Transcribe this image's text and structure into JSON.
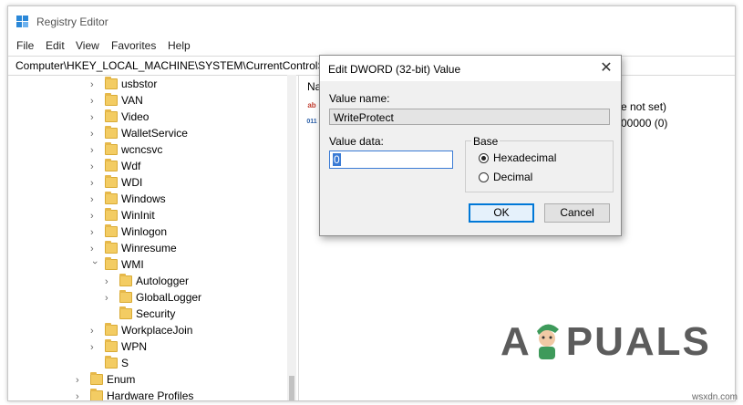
{
  "app": {
    "title": "Registry Editor",
    "menu": [
      "File",
      "Edit",
      "View",
      "Favorites",
      "Help"
    ],
    "address": "Computer\\HKEY_LOCAL_MACHINE\\SYSTEM\\CurrentControlSe"
  },
  "tree": {
    "items": [
      {
        "label": "usbstor",
        "expanded": false
      },
      {
        "label": "VAN",
        "expanded": false
      },
      {
        "label": "Video",
        "expanded": false
      },
      {
        "label": "WalletService",
        "expanded": false
      },
      {
        "label": "wcncsvc",
        "expanded": false
      },
      {
        "label": "Wdf",
        "expanded": false
      },
      {
        "label": "WDI",
        "expanded": false
      },
      {
        "label": "Windows",
        "expanded": false
      },
      {
        "label": "WinInit",
        "expanded": false
      },
      {
        "label": "Winlogon",
        "expanded": false
      },
      {
        "label": "Winresume",
        "expanded": false
      },
      {
        "label": "WMI",
        "expanded": true
      },
      {
        "label": "Autologger",
        "expanded": false
      },
      {
        "label": "GlobalLogger",
        "expanded": false
      },
      {
        "label": "Security",
        "expanded": false
      },
      {
        "label": "WorkplaceJoin",
        "expanded": false
      },
      {
        "label": "WPN",
        "expanded": false
      },
      {
        "label": "S",
        "expanded": false
      },
      {
        "label": "Enum",
        "expanded": false
      },
      {
        "label": "Hardware Profiles",
        "expanded": false
      }
    ]
  },
  "right_pane": {
    "header": "Na",
    "value_icon_1": "ab",
    "value_icon_2": "011",
    "row1_fragment": "e not set)",
    "row2_fragment": "00000 (0)"
  },
  "dialog": {
    "title": "Edit DWORD (32-bit) Value",
    "close_glyph": "✕",
    "value_name_label": "Value name:",
    "value_name": "WriteProtect",
    "value_data_label": "Value data:",
    "value_data": "0",
    "base_label": "Base",
    "radio_hex": "Hexadecimal",
    "radio_dec": "Decimal",
    "selected_base": "Hexadecimal",
    "ok_label": "OK",
    "cancel_label": "Cancel"
  },
  "watermark": {
    "left": "A",
    "right": "PUALS",
    "site": "wsxdn.com"
  },
  "colors": {
    "accent": "#0078d7",
    "folder": "#f3cc63",
    "dialog_bg": "#f0f0f0"
  }
}
